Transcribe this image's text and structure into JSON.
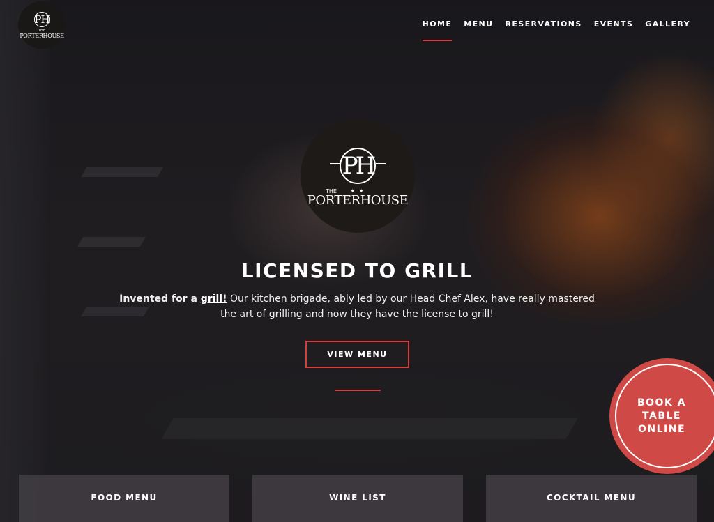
{
  "brand": {
    "monogram": "PH",
    "the": "THE",
    "name": "PORTERHOUSE",
    "stars": "★ ★"
  },
  "nav": {
    "items": [
      {
        "label": "HOME",
        "active": true
      },
      {
        "label": "MENU",
        "active": false
      },
      {
        "label": "RESERVATIONS",
        "active": false
      },
      {
        "label": "EVENTS",
        "active": false
      },
      {
        "label": "GALLERY",
        "active": false
      }
    ]
  },
  "hero": {
    "headline": "LICENSED TO GRILL",
    "intro_bold": "Invented for a ",
    "intro_link": "grill!",
    "intro_rest": " Our kitchen brigade, ably led by our Head Chef Alex, have really mastered the art of grilling and now they have the license to grill!",
    "cta_label": "VIEW MENU"
  },
  "book_table": {
    "label": "BOOK A TABLE ONLINE"
  },
  "cards": [
    {
      "label": "FOOD MENU"
    },
    {
      "label": "WINE LIST"
    },
    {
      "label": "COCKTAIL MENU"
    }
  ],
  "colors": {
    "accent": "#d23f3c",
    "book_button": "#cf4a47",
    "background": "#1d1b1d"
  },
  "icons": {
    "logo": "porterhouse-logo"
  }
}
